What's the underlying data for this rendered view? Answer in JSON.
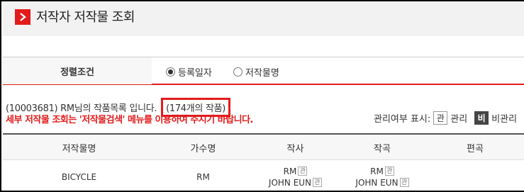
{
  "header": {
    "title": "저작자 저작물 조회",
    "icon": "chevron-right-icon",
    "accent_color": "#e31b1b"
  },
  "sort": {
    "label": "정렬조건",
    "options": [
      {
        "label": "등록일자",
        "selected": true
      },
      {
        "label": "저작물명",
        "selected": false
      }
    ]
  },
  "info": {
    "prefix": "(10003681) RM님의 작품목록 입니다.",
    "count_text": "(174개의 작품)",
    "notice": "세부 저작물 조회는 '저작물검색' 메뉴를 이용하여 주시기 바랍니다."
  },
  "legend": {
    "label": "관리여부 표시:",
    "managed_badge": "관",
    "managed_label": "관리",
    "unmanaged_badge": "비",
    "unmanaged_label": "비관리"
  },
  "table": {
    "columns": [
      "저작물명",
      "가수명",
      "작사",
      "작곡",
      "편곡"
    ],
    "rows": [
      {
        "title": "BICYCLE",
        "singer": "RM",
        "lyricists": [
          {
            "name": "RM",
            "badge": "관"
          },
          {
            "name": "JOHN EUN",
            "badge": "관"
          }
        ],
        "composers": [
          {
            "name": "RM",
            "badge": "관"
          },
          {
            "name": "JOHN EUN",
            "badge": "관"
          }
        ],
        "arranger": ""
      }
    ]
  }
}
